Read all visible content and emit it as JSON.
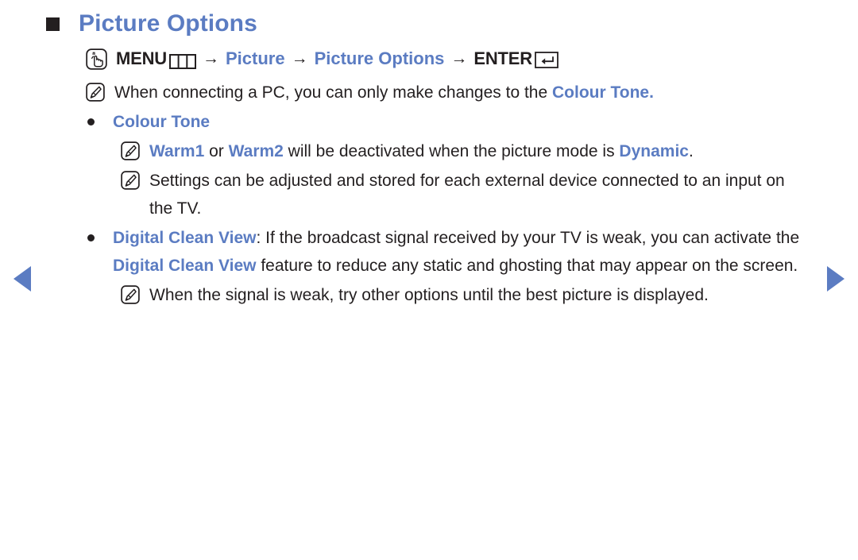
{
  "theme": {
    "accent_blue": "#5b7cc2",
    "text_black": "#231f20",
    "background": "#ffffff"
  },
  "nav": {
    "prev_label": "previous page",
    "next_label": "next page"
  },
  "section": {
    "title": "Picture Options",
    "menu_path": {
      "press_icon": "hand-press-icon",
      "menu_label": "MENU",
      "menu_glyph": "menu-grid-icon",
      "arrow": "→",
      "step1": "Picture",
      "step2": "Picture Options",
      "enter_label": "ENTER",
      "enter_glyph": "enter-return-icon"
    }
  },
  "notes": {
    "pc_connection": {
      "icon": "note-icon",
      "text_before": "When connecting a PC, you can only make changes to the ",
      "highlight": "Colour Tone.",
      "text_after": ""
    },
    "warm_modes": {
      "icon": "note-icon",
      "highlight1": "Warm1",
      "mid1": " or ",
      "highlight2": "Warm2",
      "mid2": " will be deactivated when the picture mode is ",
      "highlight3": "Dynamic",
      "tail": "."
    },
    "stored_settings": {
      "icon": "note-icon",
      "text": "Settings can be adjusted and stored for each external device connected to an input on the TV."
    },
    "weak_signal": {
      "icon": "note-icon",
      "text": "When the signal is weak, try other options until the best picture is displayed."
    }
  },
  "bullets": {
    "colour_tone": {
      "label": "Colour Tone"
    },
    "digital_clean_view": {
      "label": "Digital Clean View",
      "text_after_label": ": If the broadcast signal received by your TV is weak, you can activate the ",
      "highlight2": "Digital Clean View",
      "text_tail": " feature to reduce any static and ghosting that may appear on the screen."
    }
  }
}
